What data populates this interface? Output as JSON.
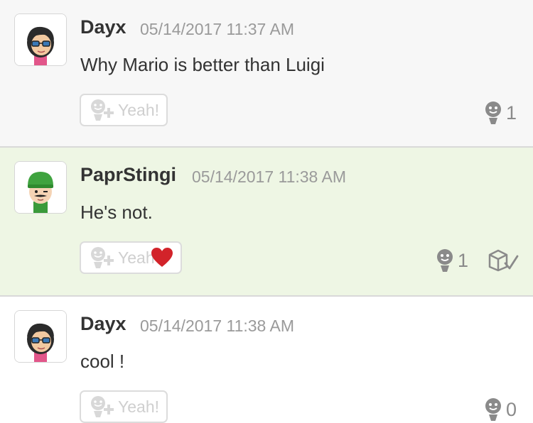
{
  "posts": [
    {
      "author": "Dayx",
      "timestamp": "05/14/2017 11:37 AM",
      "body": "Why Mario is better than Luigi",
      "yeah_label": "Yeah!",
      "yeah_count": "1",
      "yeahed": false,
      "highlighted": false
    },
    {
      "author": "PaprStingi",
      "timestamp": "05/14/2017 11:38 AM",
      "body": "He's not.",
      "yeah_label": "Yeah",
      "yeah_count": "1",
      "yeahed": true,
      "highlighted": true
    },
    {
      "author": "Dayx",
      "timestamp": "05/14/2017 11:38 AM",
      "body": "cool !",
      "yeah_label": "Yeah!",
      "yeah_count": "0",
      "yeahed": false,
      "highlighted": false
    }
  ],
  "icons": {
    "yeah_button": "yeah-plus-icon",
    "yeah_count": "yeah-count-icon",
    "heart": "heart-icon",
    "spoiler": "spoiler-icon"
  },
  "colors": {
    "highlight_bg": "#eef6e4",
    "heart": "#d2232a",
    "muted_text": "#9a9a9a"
  }
}
